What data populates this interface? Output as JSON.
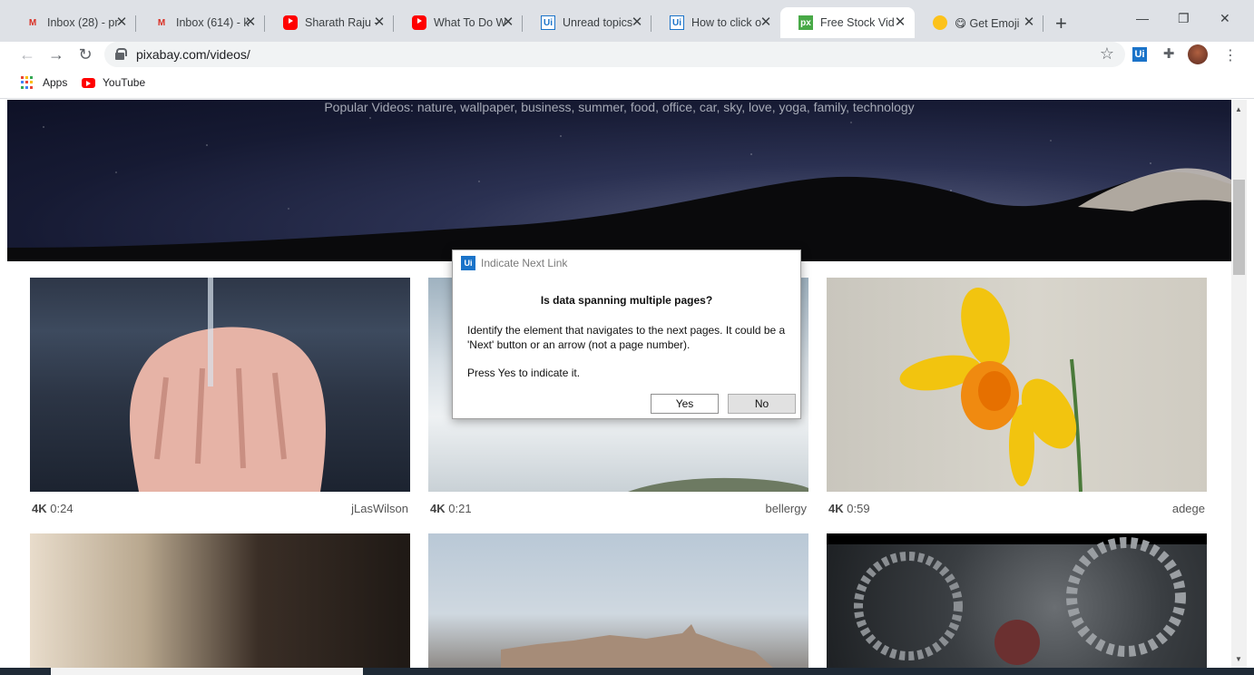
{
  "browser": {
    "tabs": [
      {
        "title": "Inbox (28) - pr",
        "icon": "gmail-icon"
      },
      {
        "title": "Inbox (614) - k",
        "icon": "gmail-icon"
      },
      {
        "title": "Sharath Raju -",
        "icon": "youtube-icon"
      },
      {
        "title": "What To Do W",
        "icon": "youtube-icon"
      },
      {
        "title": "Unread topics",
        "icon": "uipath-icon"
      },
      {
        "title": "How to click o",
        "icon": "uipath-icon"
      },
      {
        "title": "Free Stock Vid",
        "icon": "pixabay-icon",
        "active": true
      },
      {
        "title": "😋 Get Emoji",
        "icon": "emoji-icon"
      }
    ],
    "new_tab_symbol": "+",
    "window_controls": {
      "minimize": "—",
      "restore": "❐",
      "close": "✕"
    },
    "address": "pixabay.com/videos/",
    "bookmarks": [
      {
        "label": "Apps"
      },
      {
        "label": "YouTube"
      }
    ],
    "colors": {
      "accent": "#1a73c9",
      "gmail": "#d93025",
      "youtube": "#ff0000",
      "pixabay": "#48a947"
    }
  },
  "page": {
    "popular_text": "Popular Videos: nature, wallpaper, business, summer, food, office, car, sky, love, yoga, family, technology",
    "videos": [
      {
        "quality": "4K",
        "duration": "0:24",
        "user": "jLasWilson"
      },
      {
        "quality": "4K",
        "duration": "0:21",
        "user": "bellergy"
      },
      {
        "quality": "4K",
        "duration": "0:59",
        "user": "adege"
      }
    ]
  },
  "dialog": {
    "title": "Indicate Next Link",
    "logo": "Ui",
    "heading": "Is data spanning multiple pages?",
    "body1": "Identify the element that navigates to the next pages. It could be a 'Next' button or an arrow (not a page number).",
    "body2": "Press Yes to indicate it.",
    "yes_label": "Yes",
    "no_label": "No"
  }
}
